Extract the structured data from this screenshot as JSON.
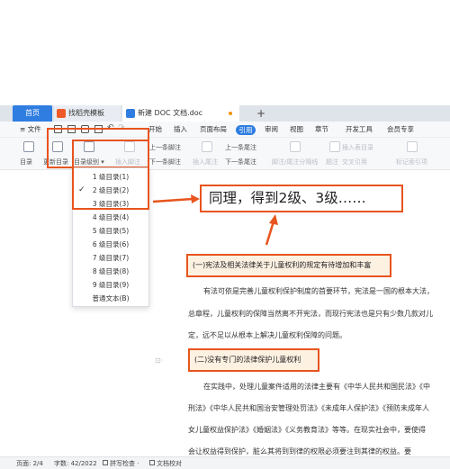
{
  "tabs": {
    "home": "首页",
    "templates": "找稻壳模板",
    "document": "新建 DOC 文档.doc",
    "new_tab": "+"
  },
  "menu": {
    "file": "≡ 文件",
    "start": "开始",
    "insert": "插入",
    "page_layout": "页面布局",
    "reference": "引用",
    "review": "审阅",
    "view": "视图",
    "section": "章节",
    "developer": "开发工具",
    "member": "会员专享"
  },
  "ribbon": {
    "toc": "目录",
    "update_toc": "更新目录",
    "toc_level": "目录级别 ▾",
    "insert_footnote": "插入脚注",
    "prev_footnote": "上一条脚注",
    "next_footnote": "下一条脚注",
    "insert_endnote": "插入尾注",
    "prev_endnote": "上一条尾注",
    "next_endnote": "下一条尾注",
    "footnote_endnote_sep": "脚注/尾注分隔线",
    "caption": "题注",
    "insert_caption": "插入表目录",
    "cross_ref": "交叉引用",
    "mark_index": "标记索引项"
  },
  "dropdown": {
    "items": [
      "1 级目录(1)",
      "2 级目录(2)",
      "3 级目录(3)",
      "4 级目录(4)",
      "5 级目录(5)",
      "6 级目录(6)",
      "7 级目录(7)",
      "8 级目录(8)",
      "9 级目录(9)",
      "普通文本(B)"
    ],
    "selected_index": 1
  },
  "callout": "同理，得到2级、3级……",
  "document": {
    "heading1": "(一)宪法及相关法律关于儿童权利的规定有待增加和丰富",
    "para1": [
      "有法可依是完善儿童权利保护制度的首要环节，宪法是一国的根本大法，",
      "总章程，儿童权利的保障当然离不开宪法，而现行宪法也是只有少数几款对儿",
      "定，远不足以从根本上解决儿童权利保障的问题。"
    ],
    "heading2": "(二)没有专门的法律保护儿童权利",
    "para2": [
      "在实践中，处理儿童案件适用的法律主要有《中华人民共和国民法》《中",
      "刑法》《中华人民共和国治安管理处罚法》《未成年人保护法》《预防未成年人",
      "女儿童权益保护法》《婚姻法》《义务教育法》等等。在现实社会中，要使得",
      "会让权益得到保护，脏么其将到到律的权限必须要注到其律的权益。要"
    ]
  },
  "status": {
    "page": "页面: 2/4",
    "words": "字数: 42/2022",
    "spell": "拼写检查 ·",
    "proof": "文档校对"
  },
  "colors": {
    "accent": "#2f7de1",
    "highlight": "#e8541e",
    "heading_fill": "#fdf1e2"
  }
}
